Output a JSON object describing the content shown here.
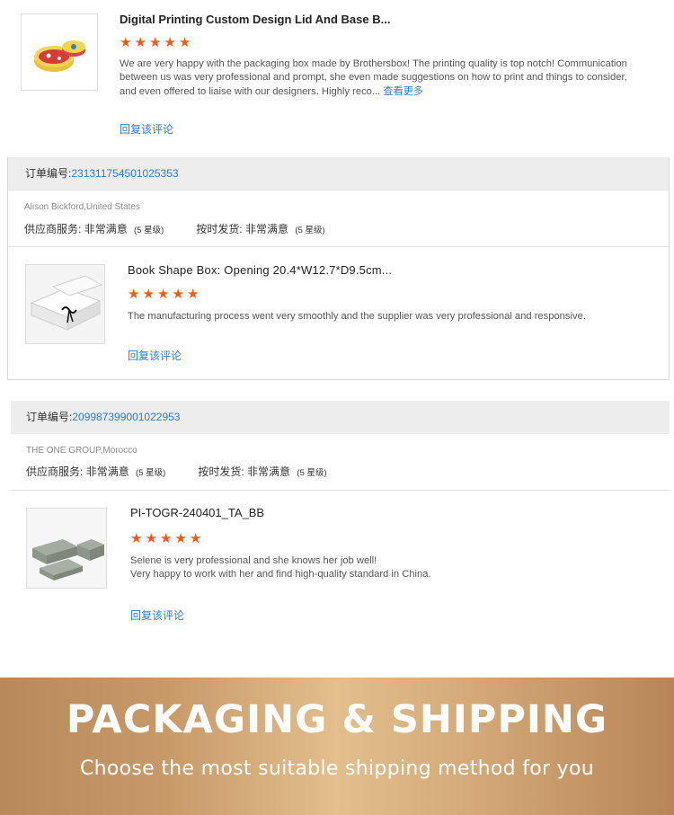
{
  "reviews": [
    {
      "product_title": "Digital Printing Custom Design Lid And Base B...",
      "stars": [
        "★",
        "★",
        "★",
        "★",
        "★"
      ],
      "text": "We are very happy with the packaging box made by Brothersbox! The printing quality is top notch! Communication between us was very professional and prompt, she even made suggestions on how to print and things to consider, and even offered to liaise with our designers. Highly reco...",
      "more_label": "查看更多",
      "reply_label": "回复该评论"
    }
  ],
  "orders": [
    {
      "order_label": "订单编号:",
      "order_number": "231311754501025353",
      "buyer": "Alison Bickford,United States",
      "supplier_service_label": "供应商服务:",
      "supplier_service_value": "非常满意",
      "supplier_service_level": "(5 星级)",
      "delivery_label": "按时发货:",
      "delivery_value": "非常满意",
      "delivery_level": "(5 星级)",
      "product_title": "Book Shape Box: Opening 20.4*W12.7*D9.5cm...",
      "stars": [
        "★",
        "★",
        "★",
        "★",
        "★"
      ],
      "text": "The manufacturing process went very smoothly and the supplier was very professional and responsive.",
      "reply_label": "回复该评论"
    },
    {
      "order_label": "订单编号:",
      "order_number": "209987399001022953",
      "buyer": "THE ONE GROUP,Morocco",
      "supplier_service_label": "供应商服务:",
      "supplier_service_value": "非常满意",
      "supplier_service_level": "(5 星级)",
      "delivery_label": "按时发货:",
      "delivery_value": "非常满意",
      "delivery_level": "(5 星级)",
      "product_title": "PI-TOGR-240401_TA_BB",
      "stars": [
        "★",
        "★",
        "★",
        "★",
        "★"
      ],
      "text_line1": "Selene is very professional and she knows her job well!",
      "text_line2": "Very happy to work with her and find high-quality standard in China.",
      "reply_label": "回复该评论"
    }
  ],
  "banner": {
    "title": "PACKAGING & SHIPPING",
    "subtitle": "Choose the most suitable shipping method for you"
  },
  "colors": {
    "link": "#2e7bcf",
    "star": "#ff5a00",
    "header_bg": "#ededed",
    "banner_gold": "#e2bf8c"
  },
  "icons": {
    "rating": "star-icon"
  }
}
